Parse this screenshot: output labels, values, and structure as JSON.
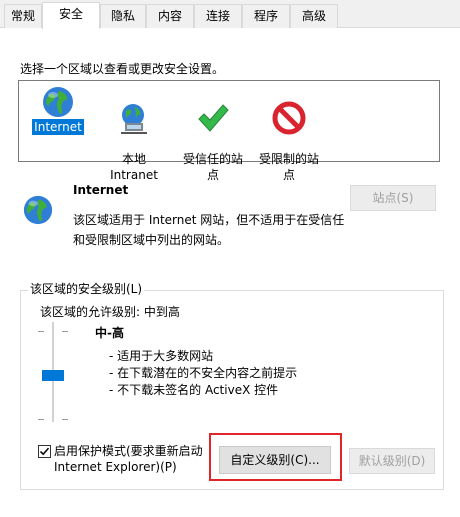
{
  "tabs": [
    {
      "label": "常规"
    },
    {
      "label": "安全"
    },
    {
      "label": "隐私"
    },
    {
      "label": "内容"
    },
    {
      "label": "连接"
    },
    {
      "label": "程序"
    },
    {
      "label": "高级"
    }
  ],
  "zones_prompt": "选择一个区域以查看或更改安全设置。",
  "zones": [
    {
      "label": "Internet",
      "icon": "globe-icon",
      "selected": true
    },
    {
      "label": "本地\nIntranet",
      "icon": "intranet-icon",
      "selected": false
    },
    {
      "label": "受信任的站\n点",
      "icon": "trusted-checkmark-icon",
      "selected": false
    },
    {
      "label": "受限制的站\n点",
      "icon": "restricted-icon",
      "selected": false
    }
  ],
  "zone_detail": {
    "title": "Internet",
    "description_line1": "该区域适用于 Internet 网站，但不适用于在受信任",
    "description_line2": "和受限制区域中列出的网站。",
    "sites_button": "站点(S)"
  },
  "security_level": {
    "group_title": "该区域的安全级别(L)",
    "allowed_levels": "该区域的允许级别: 中到高",
    "level_name": "中-高",
    "bullets": [
      "- 适用于大多数网站",
      "- 在下载潜在的不安全内容之前提示",
      "- 不下载未签名的 ActiveX 控件"
    ]
  },
  "protected_mode": {
    "checked": true,
    "label_line1": "启用保护模式(要求重新启动",
    "label_line2": "Internet Explorer)(P)"
  },
  "buttons": {
    "custom_level": "自定义级别(C)...",
    "default_level": "默认级别(D)"
  },
  "colors": {
    "selection": "#0078d7",
    "highlight_border": "#e0262a",
    "slider_thumb": "#0078d7"
  }
}
